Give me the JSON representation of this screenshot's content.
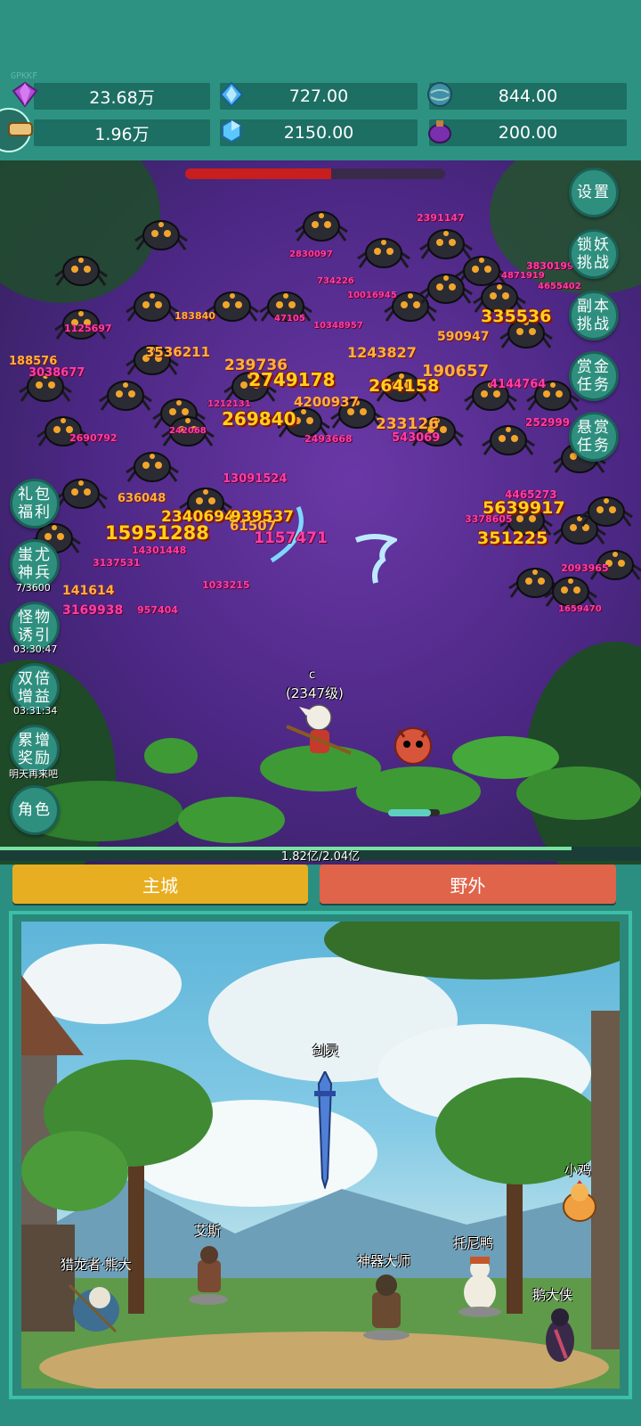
{
  "watermark": "GPKKF",
  "resources": {
    "row1": [
      {
        "icon": "purple-gem-icon",
        "value": "23.68万"
      },
      {
        "icon": "blue-crystal-icon",
        "value": "727.00"
      },
      {
        "icon": "globe-orb-icon",
        "value": "844.00"
      }
    ],
    "row2": [
      {
        "icon": "arrow-scroll-icon",
        "value": "1.96万"
      },
      {
        "icon": "blue-shard-icon",
        "value": "2150.00"
      },
      {
        "icon": "purple-potion-icon",
        "value": "200.00"
      }
    ]
  },
  "boss_hp": 0.56,
  "right_buttons": {
    "settings": "设置",
    "lock_demon": "锁妖挑战",
    "dungeon": "副本挑战",
    "bounty_gold": "赏金任务",
    "reward_task": "悬赏任务"
  },
  "left_buttons": {
    "gift": "礼包福利",
    "chiyou": "蚩尤神兵",
    "chiyou_sub": "7/3600",
    "lure": "怪物诱引",
    "lure_sub": "03:30:47",
    "double": "双倍增益",
    "double_sub": "03:31:34",
    "accum": "累增奖励",
    "accum_sub": "明天再来吧",
    "role": "角色"
  },
  "damage_numbers": [
    "2391147",
    "2830097",
    "4871919",
    "3830199",
    "4655402",
    "734226",
    "10016945",
    "1243827",
    "190657",
    "2749178",
    "239736",
    "4200937",
    "3536211",
    "183840",
    "188576",
    "3038677",
    "2690792",
    "1125697",
    "335536",
    "590947",
    "264158",
    "233126",
    "543069",
    "4144764",
    "252999",
    "2493668",
    "13091524",
    "2340694",
    "939537",
    "15951288",
    "61507",
    "1157471",
    "3137531",
    "141614",
    "3169938",
    "957404",
    "1033215",
    "5639917",
    "351225",
    "2093965",
    "269840",
    "4465273",
    "3378605",
    "47105",
    "10348957",
    "1212131",
    "242068",
    "636048",
    "14301448",
    "1659470"
  ],
  "player": {
    "name": "c",
    "level": "(2347级)"
  },
  "exp_progress": {
    "text": "1.82亿/2.04亿",
    "fraction": 0.892
  },
  "tabs": {
    "main_city": "主城",
    "wild": "野外"
  },
  "npcs": {
    "sword_spirit": "剑灵",
    "chick": "小鸡",
    "ace": "艾斯",
    "dragon_hunter": "猎龙者·熊大",
    "artifact_master": "神器大师",
    "tony_duck": "托尼鸭",
    "goose_hero": "鹅大侠"
  },
  "colors": {
    "accent": "#2d9282",
    "tab_main": "#e8ae22",
    "tab_wild": "#e0644a"
  }
}
